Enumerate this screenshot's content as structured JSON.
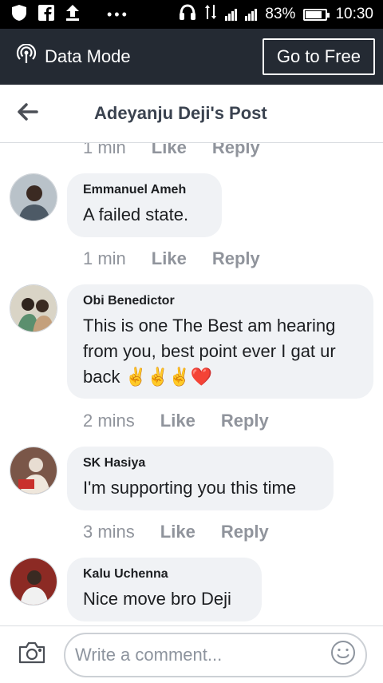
{
  "status_bar": {
    "battery": "83%",
    "battery_level": 0.83,
    "time": "10:30",
    "dots": "•••"
  },
  "data_mode": {
    "label": "Data Mode",
    "go_free": "Go to Free"
  },
  "header": {
    "title": "Adeyanju Deji's Post"
  },
  "partial_actions": {
    "time": "1 min",
    "like": "Like",
    "reply": "Reply"
  },
  "comments": [
    {
      "name": "Emmanuel Ameh",
      "text": "A failed state.",
      "time": "1 min",
      "like": "Like",
      "reply": "Reply"
    },
    {
      "name": "Obi Benedictor",
      "text": "This is one The Best am hearing from you, best point ever I gat ur back",
      "emoji": "✌️✌️✌️❤️",
      "time": "2 mins",
      "like": "Like",
      "reply": "Reply"
    },
    {
      "name": "SK Hasiya",
      "text": "I'm supporting you this time",
      "time": "3 mins",
      "like": "Like",
      "reply": "Reply"
    },
    {
      "name": "Kalu Uchenna",
      "text": "Nice move bro Deji"
    }
  ],
  "composer": {
    "placeholder": "Write a comment..."
  },
  "colors": {
    "status_bar": "#000000",
    "data_bar": "#242a33",
    "bubble": "#f0f2f5",
    "meta_text": "#90949c"
  },
  "icons": [
    "shield-icon",
    "facebook-icon",
    "upload-icon",
    "headphones-icon",
    "data-arrows-icon",
    "signal-icon",
    "battery-icon",
    "broadcast-icon",
    "back-arrow-icon",
    "camera-icon",
    "smiley-icon"
  ]
}
